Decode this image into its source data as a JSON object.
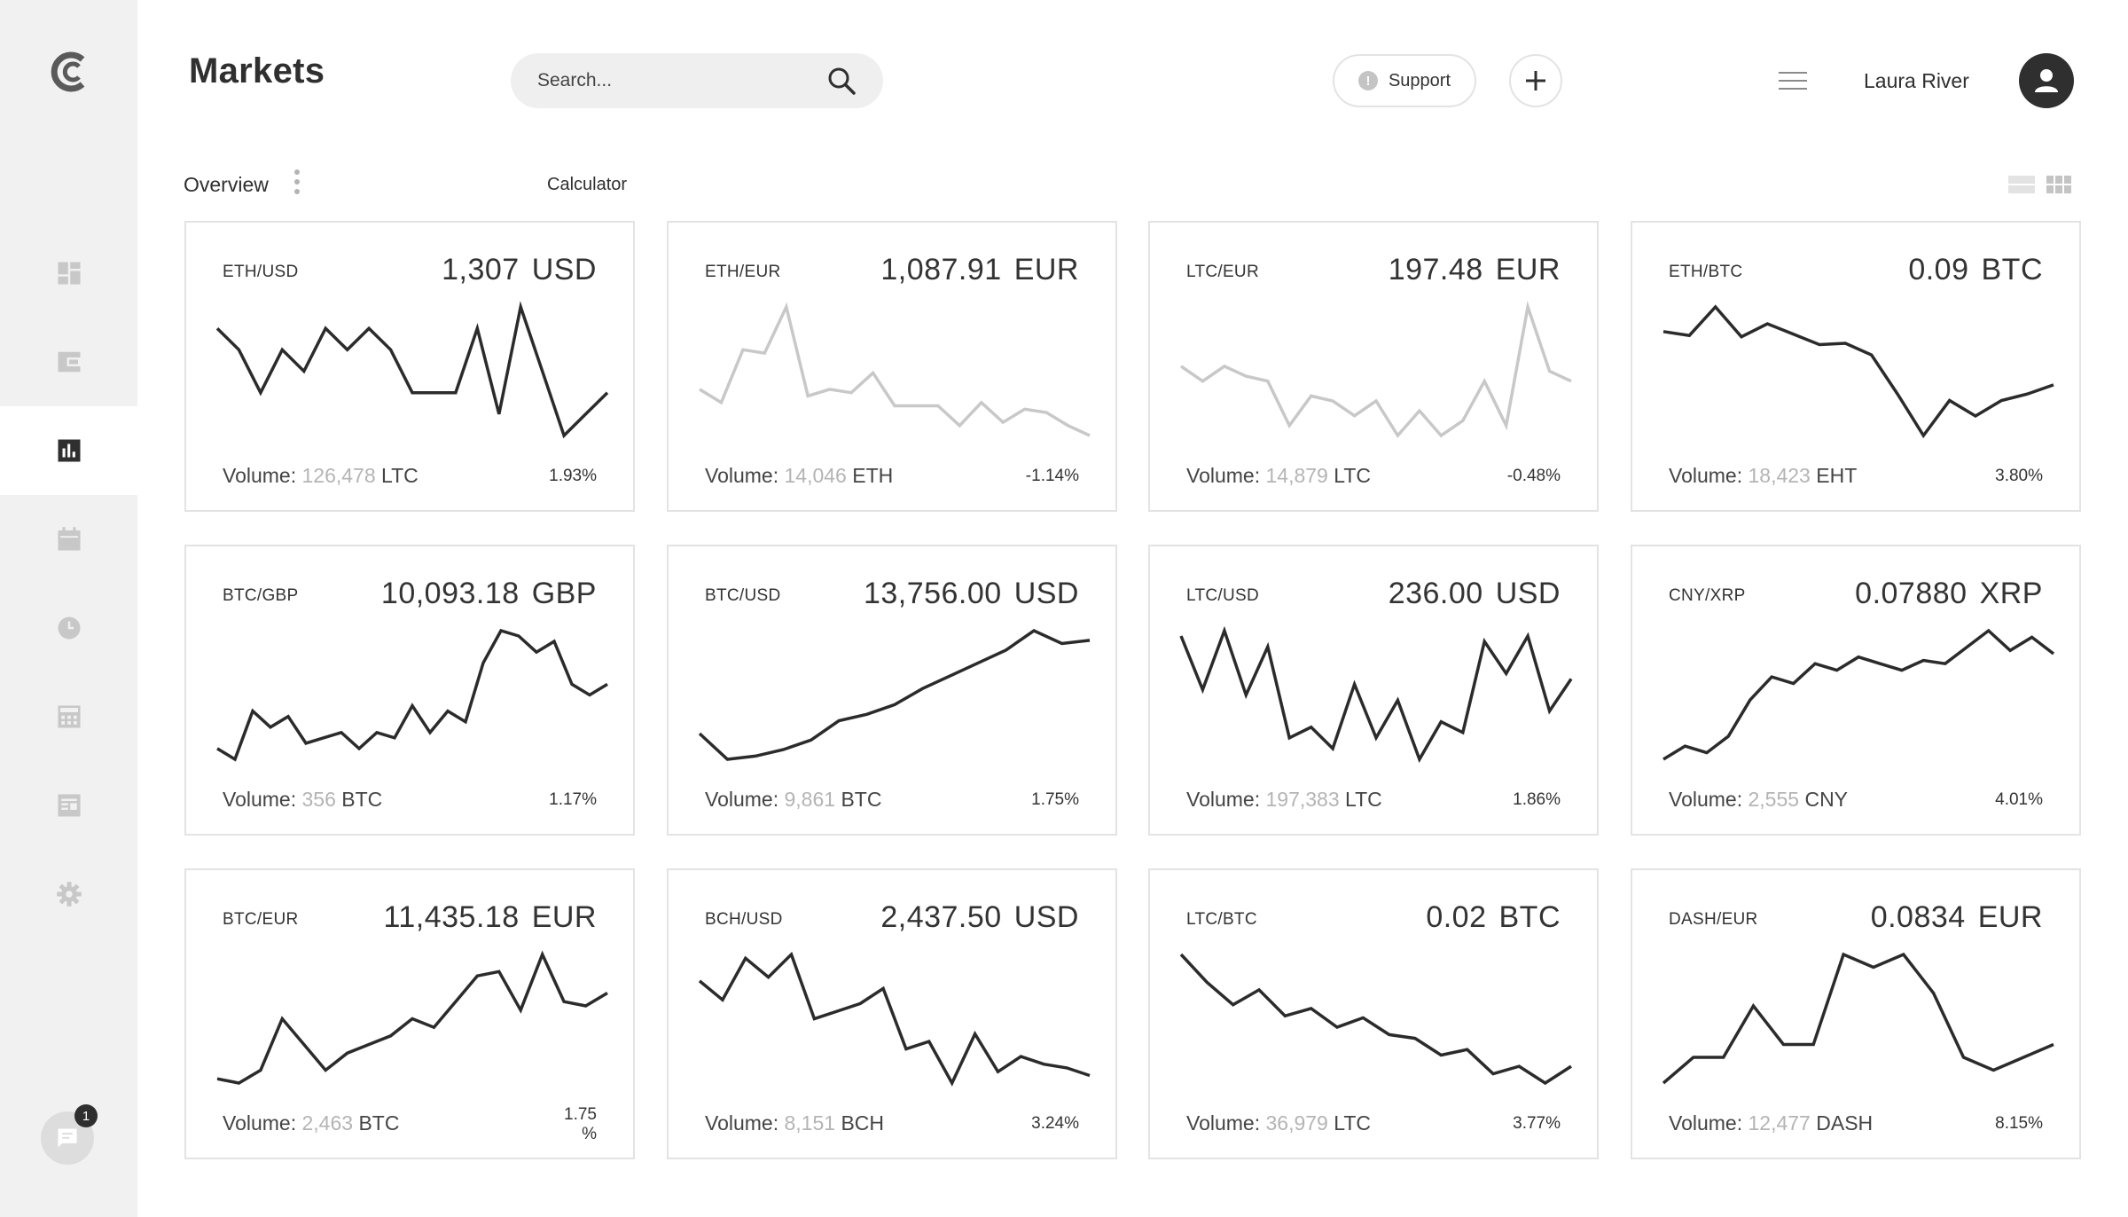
{
  "header": {
    "title": "Markets",
    "search_placeholder": "Search...",
    "support_label": "Support",
    "user_name": "Laura River"
  },
  "subheader": {
    "overview_label": "Overview",
    "calculator_label": "Calculator"
  },
  "sidebar": {
    "items": [
      {
        "name": "dashboard",
        "icon": "dashboard-icon",
        "active": false
      },
      {
        "name": "wallet",
        "icon": "wallet-icon",
        "active": false
      },
      {
        "name": "markets",
        "icon": "bar-chart-icon",
        "active": true
      },
      {
        "name": "calendar",
        "icon": "calendar-icon",
        "active": false
      },
      {
        "name": "history",
        "icon": "clock-icon",
        "active": false
      },
      {
        "name": "calculator",
        "icon": "calculator-icon",
        "active": false
      },
      {
        "name": "news",
        "icon": "newspaper-icon",
        "active": false
      },
      {
        "name": "settings",
        "icon": "gear-icon",
        "active": false
      }
    ],
    "chat_badge": "1"
  },
  "colors": {
    "text": "#2f2f2f",
    "muted": "#b4b4b4",
    "sidebar_bg": "#f1f1f1",
    "border": "#e3e3e3",
    "line_dark": "#2b2b2b",
    "line_light": "#c8c8c8"
  },
  "cards": [
    {
      "pair": "ETH/USD",
      "price": "1,307",
      "currency": "USD",
      "volume_label": "Volume:",
      "volume": "126,478",
      "volume_unit": "LTC",
      "change": "1.93%",
      "line_color": "dark",
      "series": [
        49,
        48,
        46,
        48,
        47,
        49,
        48,
        49,
        48,
        46,
        46,
        46,
        49,
        45,
        50,
        47,
        44,
        45,
        46
      ]
    },
    {
      "pair": "ETH/EUR",
      "price": "1,087.91",
      "currency": "EUR",
      "volume_label": "Volume:",
      "volume": "14,046",
      "volume_unit": "ETH",
      "change": "-1.14%",
      "line_color": "light",
      "series": [
        50,
        46,
        62,
        61,
        75,
        48,
        50,
        49,
        55,
        45,
        45,
        45,
        39,
        46,
        40,
        44,
        43,
        39,
        36
      ]
    },
    {
      "pair": "LTC/EUR",
      "price": "197.48",
      "currency": "EUR",
      "volume_label": "Volume:",
      "volume": "14,879",
      "volume_unit": "LTC",
      "change": "-0.48%",
      "line_color": "light",
      "series": [
        58,
        55,
        58,
        56,
        55,
        46,
        52,
        51,
        48,
        51,
        44,
        49,
        44,
        47,
        55,
        46,
        70,
        57,
        55
      ]
    },
    {
      "pair": "ETH/BTC",
      "price": "0.09",
      "currency": "BTC",
      "volume_label": "Volume:",
      "volume": "18,423",
      "volume_unit": "EHT",
      "change": "3.80%",
      "line_color": "dark",
      "series": [
        2.1,
        1.95,
        3.05,
        1.9,
        2.4,
        2.0,
        1.6,
        1.65,
        1.2,
        -0.3,
        -1.9,
        -0.55,
        -1.15,
        -0.55,
        -0.3,
        0.05
      ]
    },
    {
      "pair": "BTC/GBP",
      "price": "10,093.18",
      "currency": "GBP",
      "volume_label": "Volume:",
      "volume": "356",
      "volume_unit": "BTC",
      "change": "1.17%",
      "line_color": "dark",
      "series": [
        46,
        44,
        53,
        50,
        52,
        47,
        48,
        49,
        46,
        49,
        48,
        54,
        49,
        53,
        51,
        62,
        68,
        67,
        64,
        66,
        58,
        56,
        58
      ]
    },
    {
      "pair": "BTC/USD",
      "price": "13,756.00",
      "currency": "USD",
      "volume_label": "Volume:",
      "volume": "9,861",
      "volume_unit": "BTC",
      "change": "1.75%",
      "line_color": "dark",
      "series": [
        14000,
        13600,
        13650,
        13750,
        13900,
        14200,
        14300,
        14450,
        14700,
        14900,
        15100,
        15300,
        15600,
        15400,
        15450
      ]
    },
    {
      "pair": "LTC/USD",
      "price": "236.00",
      "currency": "USD",
      "volume_label": "Volume:",
      "volume": "197,383",
      "volume_unit": "LTC",
      "change": "1.86%",
      "line_color": "dark",
      "series": [
        250,
        240,
        251,
        239,
        248,
        231,
        233,
        229,
        241,
        231,
        238,
        227,
        234,
        232,
        249,
        243,
        250,
        236,
        242
      ]
    },
    {
      "pair": "CNY/XRP",
      "price": "0.07880",
      "currency": "XRP",
      "volume_label": "Volume:",
      "volume": "2,555",
      "volume_unit": "CNY",
      "change": "4.01%",
      "line_color": "dark",
      "series": [
        0.07,
        0.0704,
        0.0702,
        0.0707,
        0.0718,
        0.0725,
        0.0723,
        0.0729,
        0.0727,
        0.0731,
        0.0729,
        0.0727,
        0.073,
        0.0729,
        0.0734,
        0.0739,
        0.0733,
        0.0737,
        0.0732
      ]
    },
    {
      "pair": "BTC/EUR",
      "price": "11,435.18",
      "currency": "EUR",
      "volume_label": "Volume:",
      "volume": "2,463",
      "volume_unit": "BTC",
      "change": "1.75\n%",
      "line_color": "dark",
      "series": [
        10.3,
        10.25,
        10.4,
        11.0,
        10.7,
        10.4,
        10.6,
        10.7,
        10.8,
        11.0,
        10.9,
        11.2,
        11.5,
        11.55,
        11.1,
        11.75,
        11.2,
        11.15,
        11.3
      ]
    },
    {
      "pair": "BCH/USD",
      "price": "2,437.50",
      "currency": "USD",
      "volume_label": "Volume:",
      "volume": "8,151",
      "volume_unit": "BCH",
      "change": "3.24%",
      "line_color": "dark",
      "series": [
        2700,
        2650,
        2760,
        2710,
        2770,
        2600,
        2620,
        2640,
        2680,
        2520,
        2540,
        2430,
        2560,
        2460,
        2500,
        2480,
        2470,
        2450
      ]
    },
    {
      "pair": "LTC/BTC",
      "price": "0.02",
      "currency": "BTC",
      "volume_label": "Volume:",
      "volume": "36,979",
      "volume_unit": "LTC",
      "change": "3.77%",
      "line_color": "dark",
      "series": [
        0.0245,
        0.023,
        0.0218,
        0.0226,
        0.0212,
        0.0216,
        0.0206,
        0.0211,
        0.0202,
        0.02,
        0.0191,
        0.0194,
        0.0181,
        0.0185,
        0.0176,
        0.0185
      ]
    },
    {
      "pair": "DASH/EUR",
      "price": "0.0834",
      "currency": "EUR",
      "volume_label": "Volume:",
      "volume": "12,477",
      "volume_unit": "DASH",
      "change": "8.15%",
      "line_color": "dark",
      "series": [
        0.076,
        0.078,
        0.078,
        0.082,
        0.079,
        0.079,
        0.086,
        0.085,
        0.086,
        0.083,
        0.078,
        0.077,
        0.078,
        0.079
      ]
    }
  ]
}
